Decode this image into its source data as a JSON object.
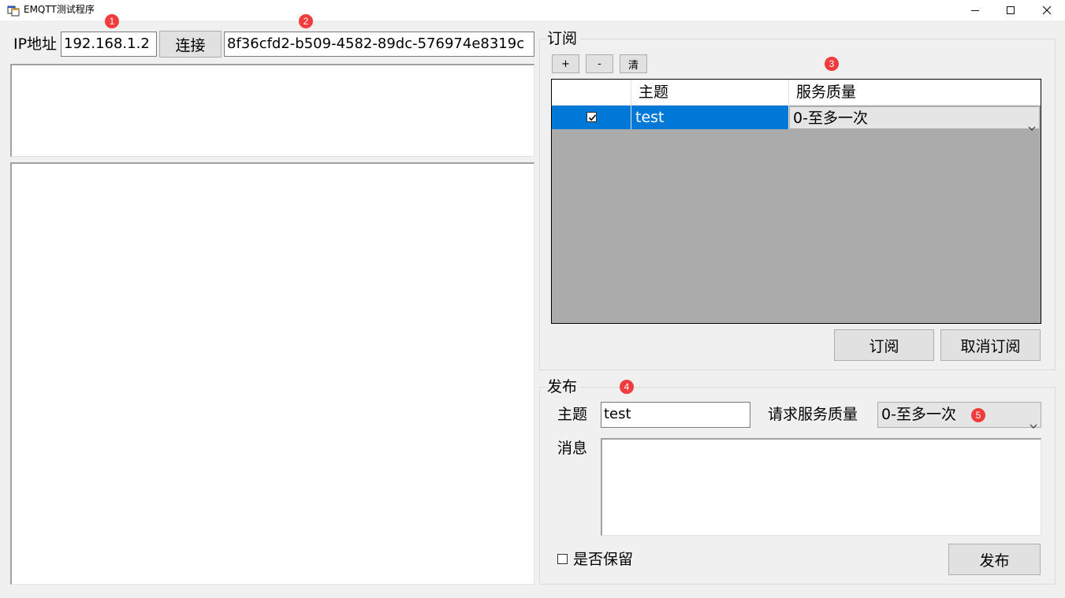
{
  "window": {
    "title": "EMQTT测试程序",
    "icon": "app-window-icon",
    "controls": [
      "minimize-icon",
      "maximize-icon",
      "close-icon"
    ]
  },
  "connection": {
    "ip_label": "IP地址",
    "ip_value": "192.168.1.2",
    "connect_label": "连接",
    "client_id": "8f36cfd2-b509-4582-89dc-576974e8319c"
  },
  "subscribe": {
    "group_title": "订阅",
    "add_label": "+",
    "remove_label": "-",
    "clear_label": "清",
    "columns": [
      "",
      "主题",
      "服务质量"
    ],
    "rows": [
      {
        "checked": true,
        "topic": "test",
        "qos": "0-至多一次"
      }
    ],
    "subscribe_label": "订阅",
    "unsubscribe_label": "取消订阅"
  },
  "publish": {
    "group_title": "发布",
    "topic_label": "主题",
    "topic_value": "test",
    "qos_label": "请求服务质量",
    "qos_value": "0-至多一次",
    "message_label": "消息",
    "message_value": "",
    "retain_label": "是否保留",
    "retain_checked": false,
    "publish_label": "发布"
  },
  "markers": [
    "1",
    "2",
    "3",
    "4",
    "5"
  ],
  "colors": {
    "selection": "#0078d7",
    "marker": "#f03c3c",
    "grid_background": "#ababab"
  }
}
